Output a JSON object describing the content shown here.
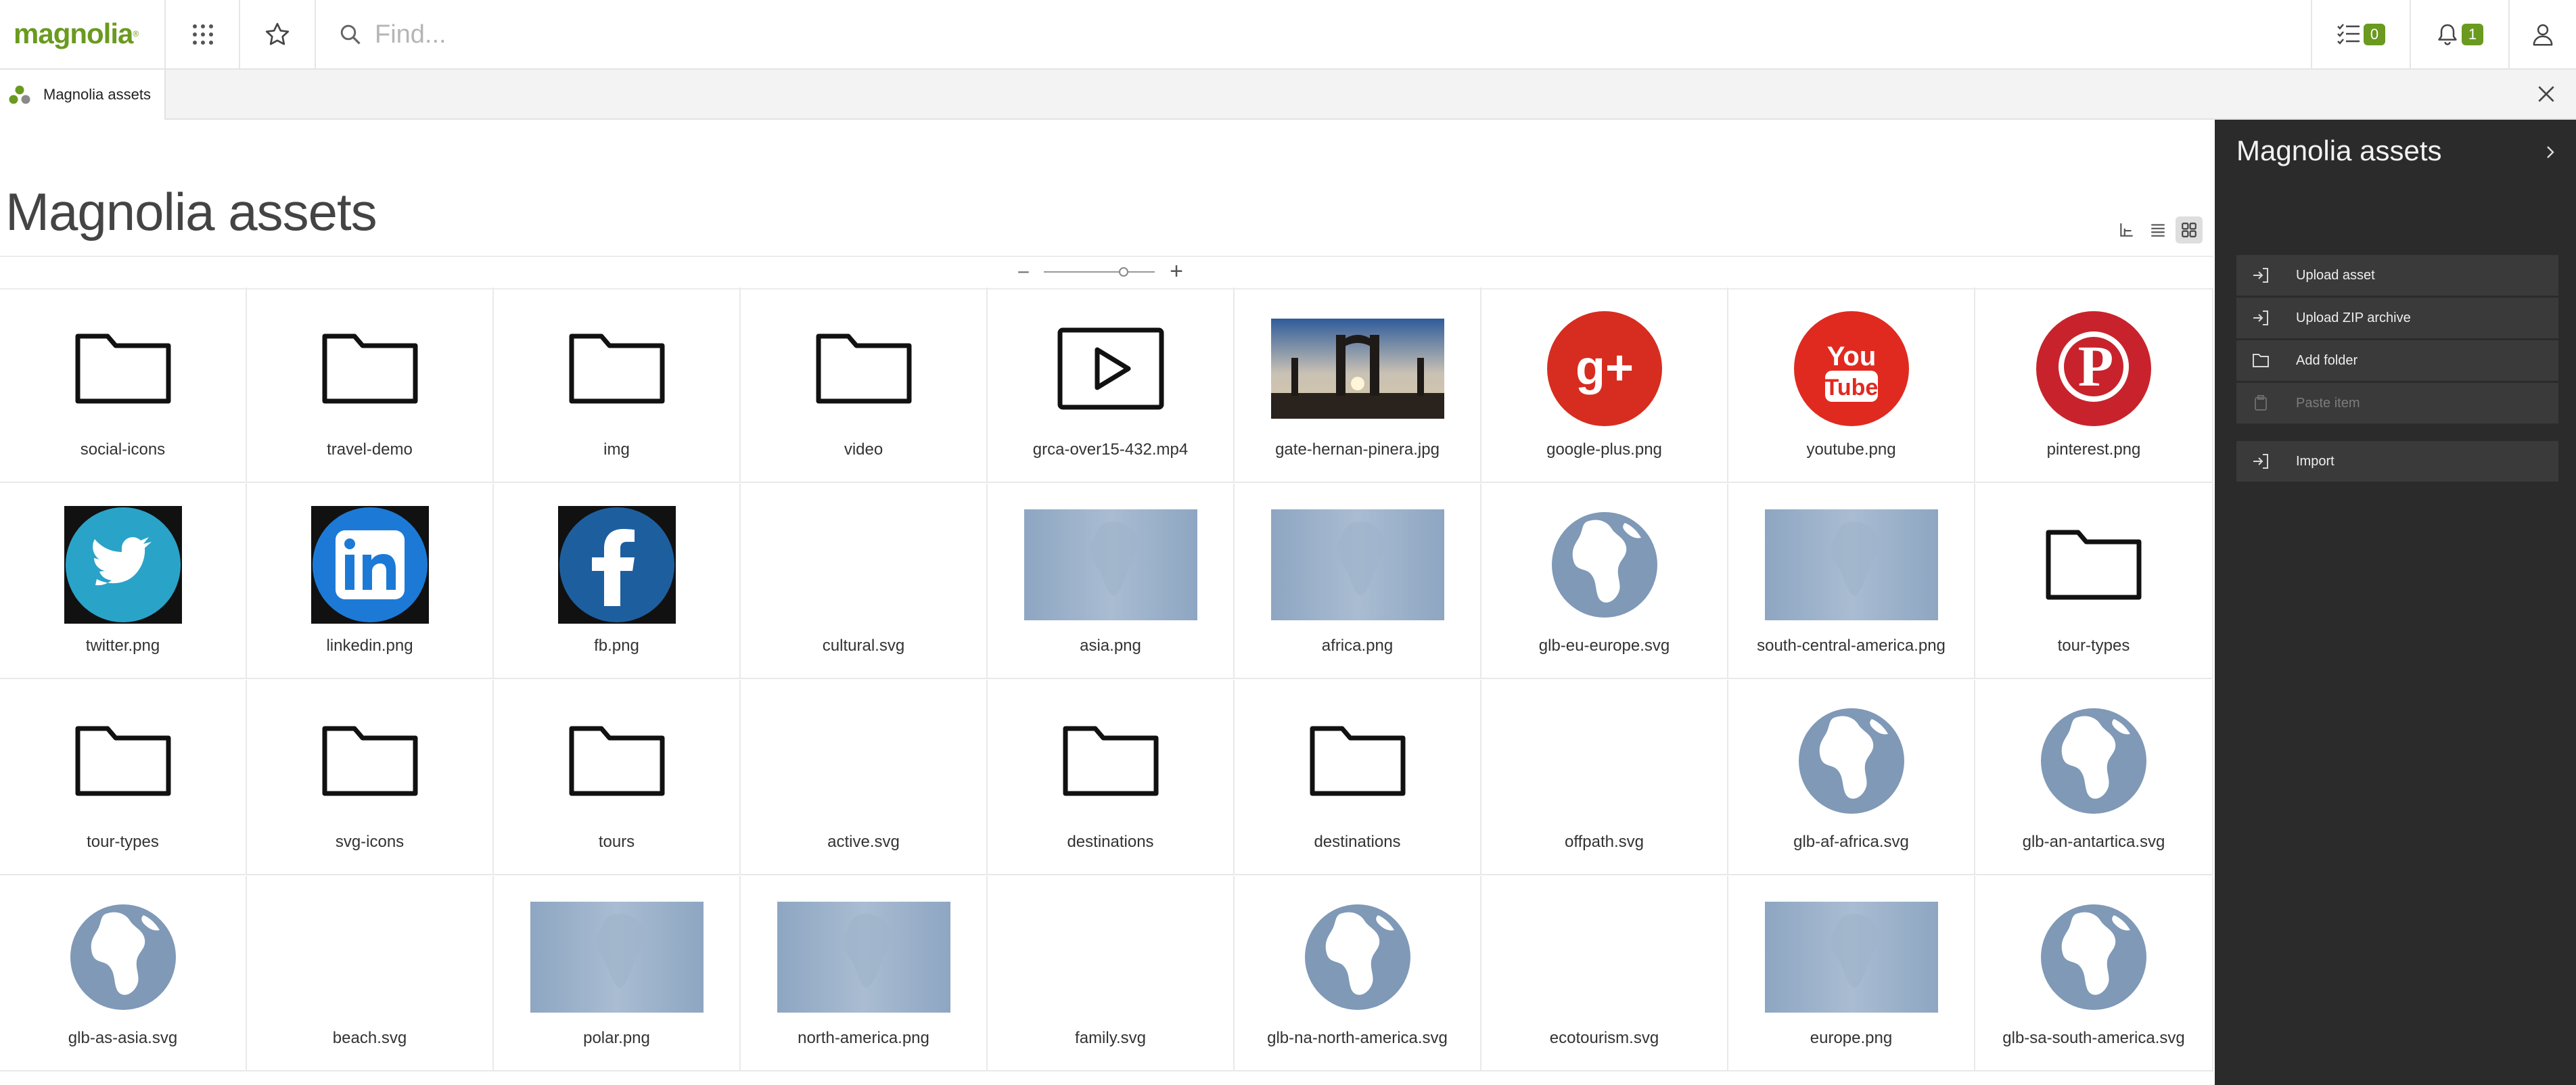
{
  "app": {
    "logo_text": "magnolia",
    "logo_reg": "®",
    "brand_color": "#6a9a1f"
  },
  "topbar": {
    "search_placeholder": "Find...",
    "tasks_count": "0",
    "notifications_count": "1",
    "icons": [
      "apps-grid-icon",
      "star-icon",
      "search-icon",
      "tasks-icon",
      "bell-icon",
      "user-icon"
    ]
  },
  "tabs": {
    "active": "Magnolia assets"
  },
  "main": {
    "title": "Magnolia assets",
    "zoom": {
      "minus": "−",
      "plus": "+",
      "level": 0.72
    },
    "view_modes": [
      "tree-view-icon",
      "list-view-icon",
      "thumbnail-view-icon"
    ]
  },
  "assets": [
    {
      "name": "social-icons",
      "type": "folder"
    },
    {
      "name": "travel-demo",
      "type": "folder"
    },
    {
      "name": "img",
      "type": "folder"
    },
    {
      "name": "video",
      "type": "folder"
    },
    {
      "name": "grca-over15-432.mp4",
      "type": "video"
    },
    {
      "name": "gate-hernan-pinera.jpg",
      "type": "photo"
    },
    {
      "name": "google-plus.png",
      "type": "google"
    },
    {
      "name": "youtube.png",
      "type": "youtube"
    },
    {
      "name": "pinterest.png",
      "type": "pinterest"
    },
    {
      "name": "twitter.png",
      "type": "twitter"
    },
    {
      "name": "linkedin.png",
      "type": "linkedin"
    },
    {
      "name": "fb.png",
      "type": "facebook"
    },
    {
      "name": "cultural.svg",
      "type": "blank"
    },
    {
      "name": "asia.png",
      "type": "map"
    },
    {
      "name": "africa.png",
      "type": "map"
    },
    {
      "name": "glb-eu-europe.svg",
      "type": "globe"
    },
    {
      "name": "south-central-america.png",
      "type": "map"
    },
    {
      "name": "tour-types",
      "type": "folder"
    },
    {
      "name": "tour-types",
      "type": "folder"
    },
    {
      "name": "svg-icons",
      "type": "folder"
    },
    {
      "name": "tours",
      "type": "folder"
    },
    {
      "name": "active.svg",
      "type": "blank"
    },
    {
      "name": "destinations",
      "type": "folder"
    },
    {
      "name": "destinations",
      "type": "folder"
    },
    {
      "name": "offpath.svg",
      "type": "blank"
    },
    {
      "name": "glb-af-africa.svg",
      "type": "globe"
    },
    {
      "name": "glb-an-antartica.svg",
      "type": "globe"
    },
    {
      "name": "glb-as-asia.svg",
      "type": "globe"
    },
    {
      "name": "beach.svg",
      "type": "blank"
    },
    {
      "name": "polar.png",
      "type": "map"
    },
    {
      "name": "north-america.png",
      "type": "map"
    },
    {
      "name": "family.svg",
      "type": "blank"
    },
    {
      "name": "glb-na-north-america.svg",
      "type": "globe"
    },
    {
      "name": "ecotourism.svg",
      "type": "blank"
    },
    {
      "name": "europe.png",
      "type": "map"
    },
    {
      "name": "glb-sa-south-america.svg",
      "type": "globe"
    }
  ],
  "panel": {
    "title": "Magnolia assets",
    "actions": [
      {
        "label": "Upload asset",
        "icon": "upload-icon",
        "enabled": true
      },
      {
        "label": "Upload ZIP archive",
        "icon": "upload-zip-icon",
        "enabled": true
      },
      {
        "label": "Add folder",
        "icon": "add-folder-icon",
        "enabled": true
      },
      {
        "label": "Paste item",
        "icon": "paste-icon",
        "enabled": false
      },
      {
        "label": "Import",
        "icon": "import-icon",
        "enabled": true
      }
    ]
  }
}
